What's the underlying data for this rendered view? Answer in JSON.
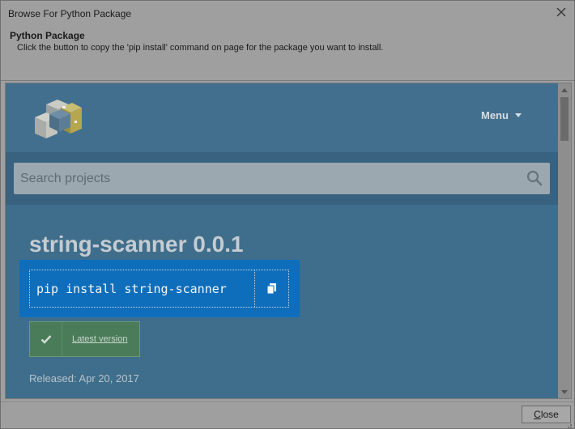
{
  "window": {
    "title": "Browse For Python Package",
    "close_icon": "close-icon"
  },
  "header": {
    "title": "Python Package",
    "description": "Click the button to copy the 'pip install' command on page for the package you want to install."
  },
  "site": {
    "logo_icon": "pypi-logo-icon",
    "menu_label": "Menu",
    "search": {
      "placeholder": "Search projects",
      "icon": "search-icon"
    }
  },
  "package": {
    "title": "string-scanner 0.0.1",
    "pip_command": "pip install string-scanner",
    "copy_icon": "copy-icon",
    "version_button": "Latest version",
    "released": "Released: Apr 20, 2017"
  },
  "footer": {
    "close_label_first": "C",
    "close_label_rest": "lose"
  },
  "colors": {
    "site_bg": "#3f6e8c",
    "highlight": "#0e6ebc",
    "version_green": "#4b7c5a"
  }
}
